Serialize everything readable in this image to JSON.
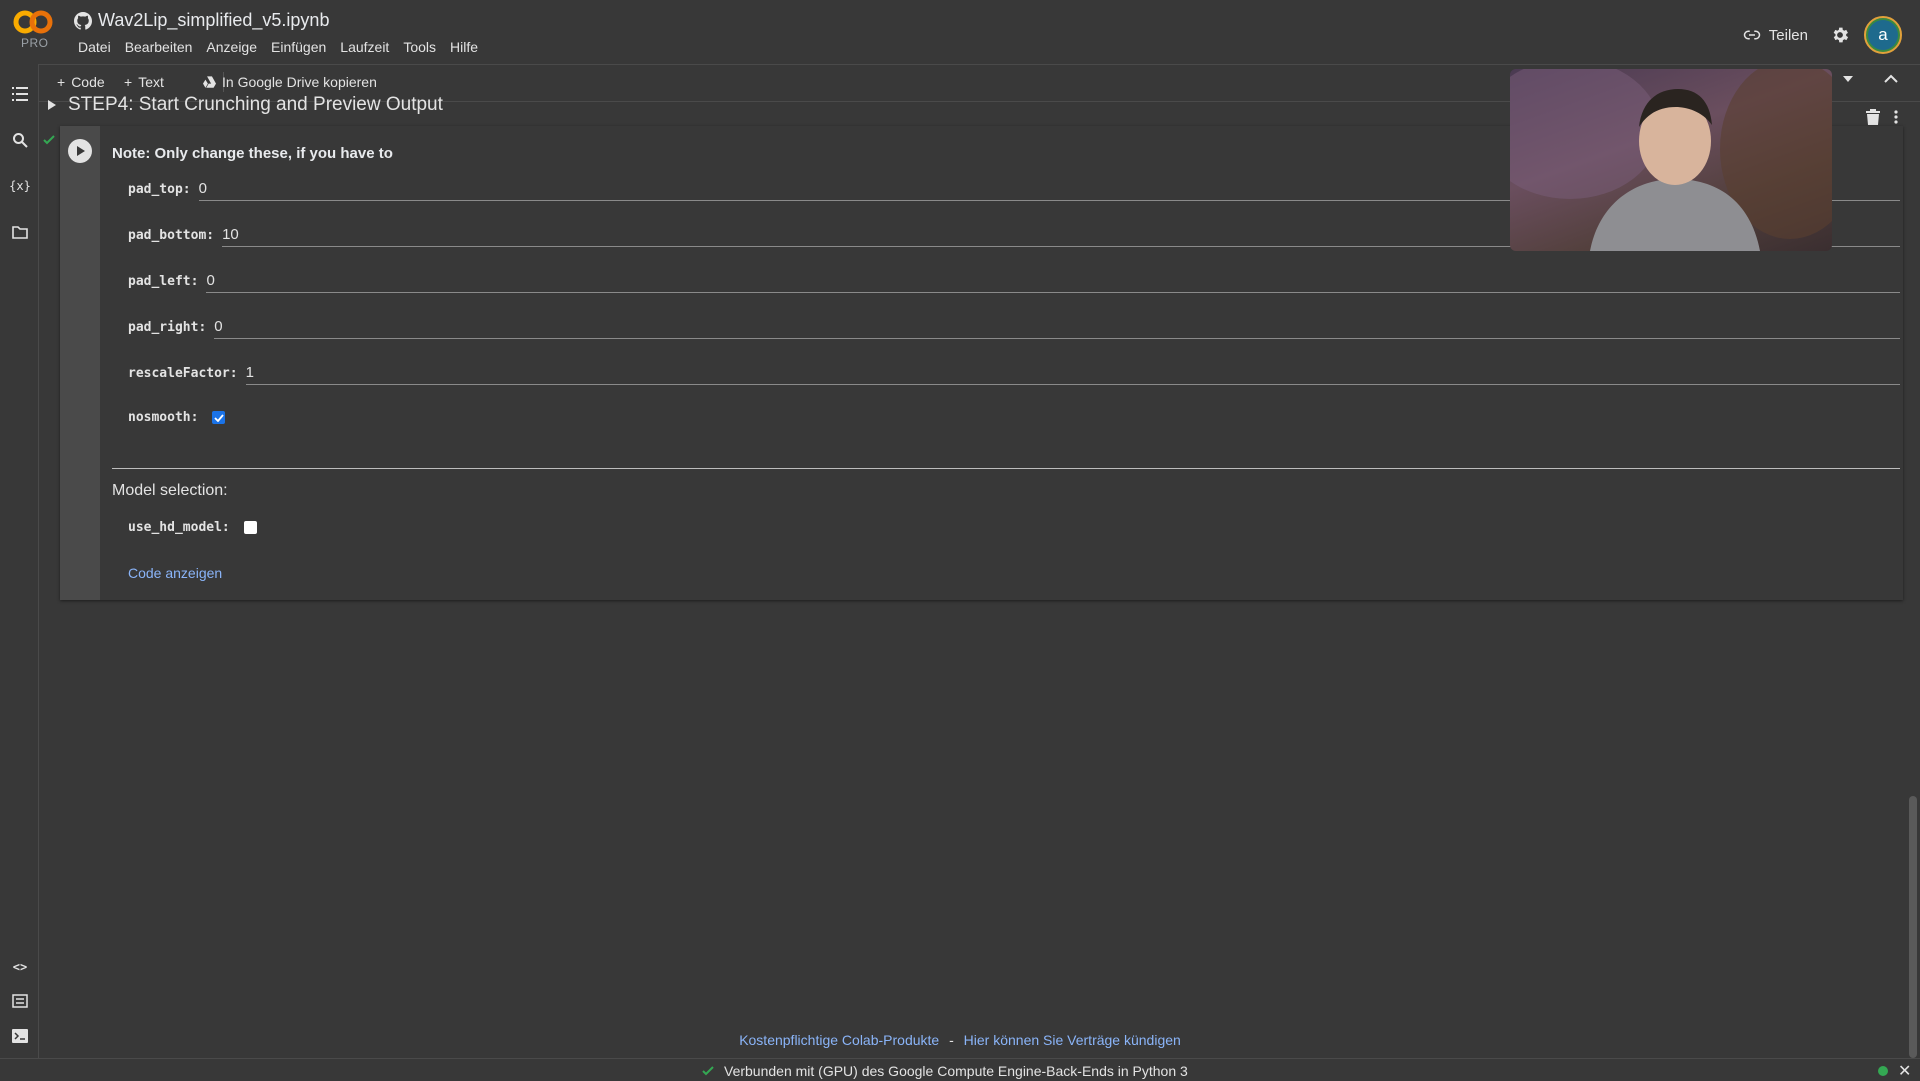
{
  "app": {
    "logo_badge": "PRO",
    "notebook_title": "Wav2Lip_simplified_v5.ipynb"
  },
  "menu": [
    "Datei",
    "Bearbeiten",
    "Anzeige",
    "Einfügen",
    "Laufzeit",
    "Tools",
    "Hilfe"
  ],
  "header": {
    "share_label": "Teilen",
    "avatar_letter": "a"
  },
  "toolbar": {
    "add_code": "Code",
    "add_text": "Text",
    "copy_drive": "In Google Drive kopieren"
  },
  "section": {
    "title": "STEP4: Start Crunching and Preview Output"
  },
  "form": {
    "note": "Note: Only change these, if you have to",
    "fields": [
      {
        "label": "pad_top:",
        "value": "0"
      },
      {
        "label": "pad_bottom:",
        "value": "10"
      },
      {
        "label": "pad_left:",
        "value": "0"
      },
      {
        "label": "pad_right:",
        "value": "0"
      },
      {
        "label": "rescaleFactor:",
        "value": "1"
      }
    ],
    "nosmooth": {
      "label": "nosmooth:",
      "checked": true
    },
    "model_heading": "Model selection:",
    "use_hd_model": {
      "label": "use_hd_model:",
      "checked": false
    },
    "show_code": "Code anzeigen"
  },
  "footer": {
    "link_products": "Kostenpflichtige Colab-Produkte",
    "separator": "-",
    "link_cancel": "Hier können Sie Verträge kündigen",
    "status": "Verbunden mit (GPU) des Google Compute Engine-Back-Ends in Python 3"
  },
  "colors": {
    "background": "#383838",
    "link": "#8ab4f8",
    "checkbox_checked": "#1a73e8",
    "status_connected": "#34a853",
    "logo_orange": "#f9ab00"
  },
  "icons": [
    "table-of-contents-icon",
    "search-icon",
    "variables-icon",
    "folder-icon",
    "code-snippets-icon",
    "command-palette-icon",
    "terminal-icon",
    "github-icon",
    "link-icon",
    "gear-icon",
    "play-icon",
    "check-icon",
    "delete-icon",
    "more-vert-icon",
    "drive-icon",
    "chevron-up-icon",
    "chevron-down-icon",
    "caret-right-icon"
  ]
}
